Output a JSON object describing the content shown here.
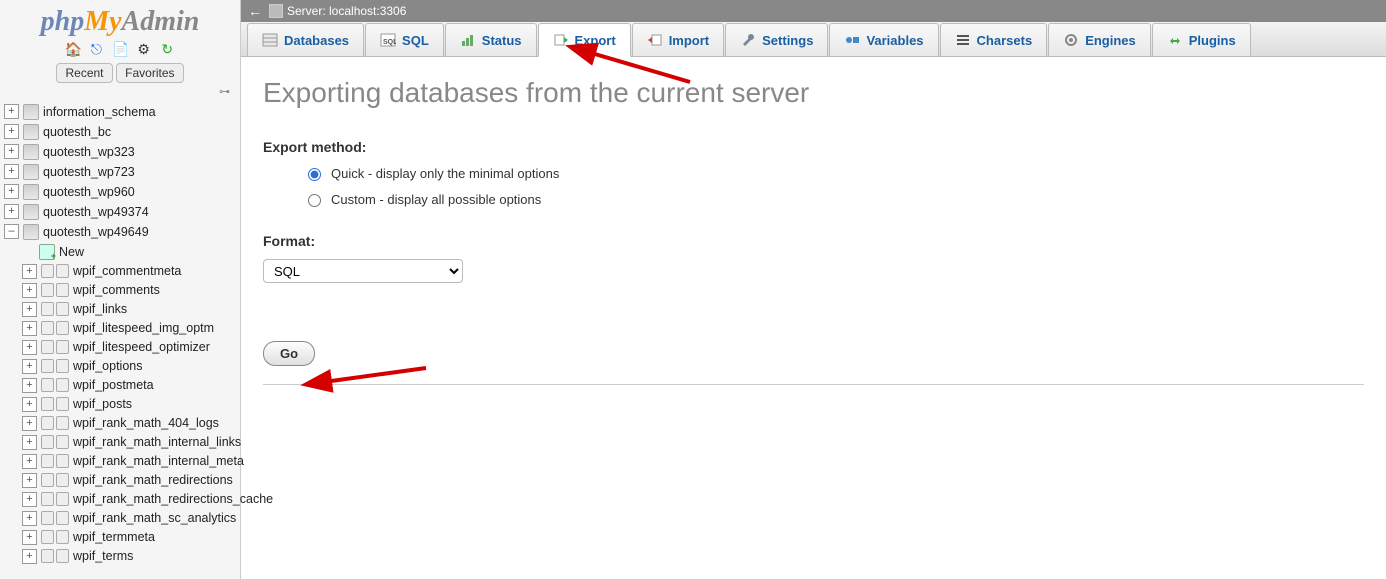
{
  "logo": {
    "php": "php",
    "my": "My",
    "admin": "Admin"
  },
  "sidebar": {
    "recent": "Recent",
    "favorites": "Favorites",
    "new_label": "New",
    "dbs": [
      {
        "name": "information_schema",
        "expanded": false
      },
      {
        "name": "quotesth_bc",
        "expanded": false
      },
      {
        "name": "quotesth_wp323",
        "expanded": false
      },
      {
        "name": "quotesth_wp723",
        "expanded": false
      },
      {
        "name": "quotesth_wp960",
        "expanded": false
      },
      {
        "name": "quotesth_wp49374",
        "expanded": false
      },
      {
        "name": "quotesth_wp49649",
        "expanded": true
      }
    ],
    "tables": [
      "wpif_commentmeta",
      "wpif_comments",
      "wpif_links",
      "wpif_litespeed_img_optm",
      "wpif_litespeed_optimizer",
      "wpif_options",
      "wpif_postmeta",
      "wpif_posts",
      "wpif_rank_math_404_logs",
      "wpif_rank_math_internal_links",
      "wpif_rank_math_internal_meta",
      "wpif_rank_math_redirections",
      "wpif_rank_math_redirections_cache",
      "wpif_rank_math_sc_analytics",
      "wpif_termmeta",
      "wpif_terms"
    ]
  },
  "server_bar": {
    "label": "Server: localhost:3306"
  },
  "tabs": [
    {
      "key": "databases",
      "label": "Databases"
    },
    {
      "key": "sql",
      "label": "SQL"
    },
    {
      "key": "status",
      "label": "Status"
    },
    {
      "key": "export",
      "label": "Export",
      "active": true
    },
    {
      "key": "import",
      "label": "Import"
    },
    {
      "key": "settings",
      "label": "Settings"
    },
    {
      "key": "variables",
      "label": "Variables"
    },
    {
      "key": "charsets",
      "label": "Charsets"
    },
    {
      "key": "engines",
      "label": "Engines"
    },
    {
      "key": "plugins",
      "label": "Plugins"
    }
  ],
  "page": {
    "title": "Exporting databases from the current server",
    "export_method_label": "Export method:",
    "method_quick": "Quick - display only the minimal options",
    "method_custom": "Custom - display all possible options",
    "format_label": "Format:",
    "format_value": "SQL",
    "go_label": "Go"
  },
  "colors": {
    "link": "#1a5ea3",
    "arrow": "#d40000"
  }
}
